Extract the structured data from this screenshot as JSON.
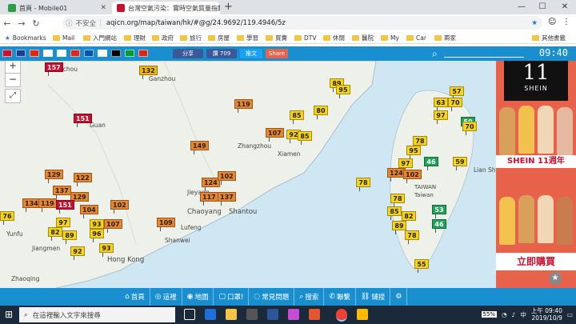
{
  "browser": {
    "tabs": [
      {
        "title": "首頁 - Mobile01",
        "active": false
      },
      {
        "title": "台灣空氣污染：實時空氣質量指數",
        "active": true
      }
    ],
    "new_tab": "+",
    "security_label": "不安全",
    "url": "aqicn.org/map/taiwan/hk/#@g/24.9692/119.4946/5z",
    "bookmarks": [
      "Bookmarks",
      "Mail",
      "入門網站",
      "理財",
      "政府",
      "旅行",
      "房屋",
      "學習",
      "買賣",
      "DTV",
      "休閒",
      "醫院",
      "My",
      "Car",
      "兩家",
      "其他書籤"
    ]
  },
  "site": {
    "share_label": "分享",
    "like_label": "讚 709",
    "tweet_label": "推文",
    "share2_label": "Share",
    "clock": "09:40"
  },
  "map": {
    "labels": [
      {
        "text": "Ganzhou"
      },
      {
        "text": "Guan"
      },
      {
        "text": "Zhangzhou"
      },
      {
        "text": "Xiamen"
      },
      {
        "text": "Jieyang"
      },
      {
        "text": "Chaoyang"
      },
      {
        "text": "Shantou"
      },
      {
        "text": "Shanwei"
      },
      {
        "text": "Lufeng"
      },
      {
        "text": "Hong Kong"
      },
      {
        "text": "Yunfu"
      },
      {
        "text": "Jiangmen"
      },
      {
        "text": "Taiwan"
      },
      {
        "text": "TAIWAN"
      },
      {
        "text": "Lian Sh"
      },
      {
        "text": "Zhaoqing"
      },
      {
        "text": "nchou"
      }
    ],
    "markers": [
      {
        "v": "157",
        "c": "#c8102e"
      },
      {
        "v": "132",
        "c": "#f2b705"
      },
      {
        "v": "119",
        "c": "#e8862e"
      },
      {
        "v": "151",
        "c": "#c8102e"
      },
      {
        "v": "107",
        "c": "#e8862e"
      },
      {
        "v": "85",
        "c": "#f7d417"
      },
      {
        "v": "92",
        "c": "#f7d417"
      },
      {
        "v": "85",
        "c": "#f7d417"
      },
      {
        "v": "149",
        "c": "#e8862e"
      },
      {
        "v": "129",
        "c": "#e8862e"
      },
      {
        "v": "122",
        "c": "#e8862e"
      },
      {
        "v": "137",
        "c": "#e8862e"
      },
      {
        "v": "129",
        "c": "#e8862e"
      },
      {
        "v": "134",
        "c": "#e8862e"
      },
      {
        "v": "119",
        "c": "#e8862e"
      },
      {
        "v": "151",
        "c": "#c8102e"
      },
      {
        "v": "104",
        "c": "#e8862e"
      },
      {
        "v": "102",
        "c": "#e8862e"
      },
      {
        "v": "124",
        "c": "#e8862e"
      },
      {
        "v": "102",
        "c": "#e8862e"
      },
      {
        "v": "137",
        "c": "#e8862e"
      },
      {
        "v": "117",
        "c": "#e8862e"
      },
      {
        "v": "76",
        "c": "#f7d417"
      },
      {
        "v": "97",
        "c": "#f7d417"
      },
      {
        "v": "82",
        "c": "#f7d417"
      },
      {
        "v": "89",
        "c": "#f7d417"
      },
      {
        "v": "93",
        "c": "#f7d417"
      },
      {
        "v": "107",
        "c": "#e8862e"
      },
      {
        "v": "109",
        "c": "#e8862e"
      },
      {
        "v": "96",
        "c": "#f7d417"
      },
      {
        "v": "92",
        "c": "#f7d417"
      },
      {
        "v": "93",
        "c": "#f7d417"
      },
      {
        "v": "89",
        "c": "#f7d417"
      },
      {
        "v": "95",
        "c": "#f7d417"
      },
      {
        "v": "80",
        "c": "#f7d417"
      },
      {
        "v": "78",
        "c": "#f7d417"
      },
      {
        "v": "57",
        "c": "#f7d417"
      },
      {
        "v": "63",
        "c": "#f7d417"
      },
      {
        "v": "70",
        "c": "#f7d417"
      },
      {
        "v": "97",
        "c": "#f7d417"
      },
      {
        "v": "50",
        "c": "#1fa35a"
      },
      {
        "v": "70",
        "c": "#f7d417"
      },
      {
        "v": "78",
        "c": "#f7d417"
      },
      {
        "v": "95",
        "c": "#f7d417"
      },
      {
        "v": "97",
        "c": "#f7d417"
      },
      {
        "v": "46",
        "c": "#1fa35a"
      },
      {
        "v": "59",
        "c": "#f7d417"
      },
      {
        "v": "124",
        "c": "#e8862e"
      },
      {
        "v": "102",
        "c": "#e8862e"
      },
      {
        "v": "78",
        "c": "#f7d417"
      },
      {
        "v": "53",
        "c": "#1fa35a"
      },
      {
        "v": "46",
        "c": "#1fa35a"
      },
      {
        "v": "85",
        "c": "#f7d417"
      },
      {
        "v": "82",
        "c": "#f7d417"
      },
      {
        "v": "89",
        "c": "#f7d417"
      },
      {
        "v": "78",
        "c": "#f7d417"
      },
      {
        "v": "55",
        "c": "#f7d417"
      }
    ]
  },
  "ad": {
    "brand": "SHEIN",
    "number": "11",
    "anniv": "SHEIN 11週年",
    "cta": "立即購買"
  },
  "bottom_nav": [
    {
      "icon": "⌂",
      "label": "首頁"
    },
    {
      "icon": "◎",
      "label": "這裡"
    },
    {
      "icon": "◉",
      "label": "地圖"
    },
    {
      "icon": "▢",
      "label": "口罩!"
    },
    {
      "icon": "◌",
      "label": "常見問題"
    },
    {
      "icon": "⌕",
      "label": "搜索"
    },
    {
      "icon": "✆",
      "label": "聯繫"
    },
    {
      "icon": "⛓",
      "label": "鏈接"
    },
    {
      "icon": "⚙",
      "label": ""
    }
  ],
  "taskbar": {
    "search_placeholder": "在這裡輸入文字來搜尋",
    "battery": "55%",
    "time": "上午 09:40",
    "date": "2019/10/9"
  }
}
